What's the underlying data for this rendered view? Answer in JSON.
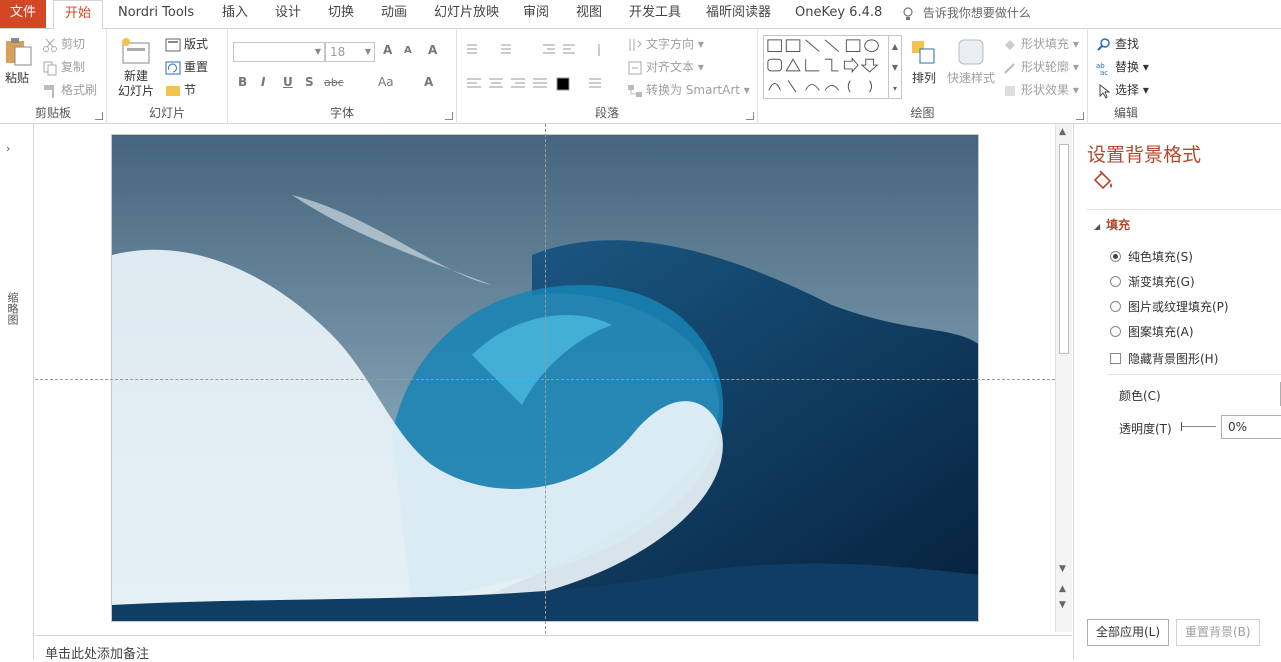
{
  "tabs": [
    {
      "label": "文件"
    },
    {
      "label": "开始"
    },
    {
      "label": "Nordri Tools"
    },
    {
      "label": "插入"
    },
    {
      "label": "设计"
    },
    {
      "label": "切换"
    },
    {
      "label": "动画"
    },
    {
      "label": "幻灯片放映"
    },
    {
      "label": "审阅"
    },
    {
      "label": "视图"
    },
    {
      "label": "开发工具"
    },
    {
      "label": "福昕阅读器"
    },
    {
      "label": "OneKey 6.4.8"
    }
  ],
  "tell_me": "告诉我你想要做什么",
  "clipboard": {
    "paste": "粘贴",
    "cut": "剪切",
    "copy": "复制",
    "painter": "格式刷",
    "label": "剪贴板"
  },
  "slides": {
    "new": "新建",
    "new2": "幻灯片",
    "layout": "版式",
    "reset": "重置",
    "section": "节",
    "label": "幻灯片"
  },
  "font": {
    "size": "18",
    "label": "字体",
    "bold": "B",
    "italic": "I",
    "underline": "U",
    "shadow": "S",
    "strike": "abc",
    "aa": "Aa",
    "grow": "A",
    "shrink": "A",
    "color": "A"
  },
  "paragraph": {
    "dir": "文字方向",
    "align": "对齐文本",
    "smartart": "转换为 SmartArt",
    "label": "段落"
  },
  "drawing": {
    "arrange": "排列",
    "quick": "快速样式",
    "fill": "形状填充",
    "outline": "形状轮廓",
    "effect": "形状效果",
    "label": "绘图"
  },
  "editing": {
    "find": "查找",
    "replace": "替换",
    "select": "选择",
    "label": "编辑"
  },
  "left_panel": "缩略图",
  "notes": "单击此处添加备注",
  "pane": {
    "title": "设置背景格式",
    "section": "填充",
    "options": [
      "纯色填充(S)",
      "渐变填充(G)",
      "图片或纹理填充(P)",
      "图案填充(A)"
    ],
    "hide": "隐藏背景图形(H)",
    "color_label": "颜色(C)",
    "trans_label": "透明度(T)",
    "trans_value": "0%",
    "apply_all": "全部应用(L)",
    "reset": "重置背景(B)"
  },
  "colors": {
    "accent": "#d24726",
    "pane_title": "#b7472a"
  }
}
